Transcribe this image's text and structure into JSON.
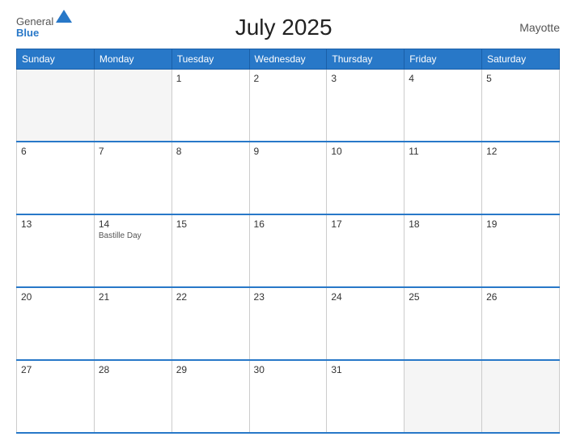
{
  "header": {
    "logo_general": "General",
    "logo_blue": "Blue",
    "title": "July 2025",
    "region": "Mayotte"
  },
  "days_of_week": [
    "Sunday",
    "Monday",
    "Tuesday",
    "Wednesday",
    "Thursday",
    "Friday",
    "Saturday"
  ],
  "weeks": [
    [
      {
        "num": "",
        "empty": true
      },
      {
        "num": "",
        "empty": true
      },
      {
        "num": "1",
        "empty": false
      },
      {
        "num": "2",
        "empty": false
      },
      {
        "num": "3",
        "empty": false
      },
      {
        "num": "4",
        "empty": false
      },
      {
        "num": "5",
        "empty": false
      }
    ],
    [
      {
        "num": "6",
        "empty": false
      },
      {
        "num": "7",
        "empty": false
      },
      {
        "num": "8",
        "empty": false
      },
      {
        "num": "9",
        "empty": false
      },
      {
        "num": "10",
        "empty": false
      },
      {
        "num": "11",
        "empty": false
      },
      {
        "num": "12",
        "empty": false
      }
    ],
    [
      {
        "num": "13",
        "empty": false
      },
      {
        "num": "14",
        "holiday": "Bastille Day",
        "empty": false
      },
      {
        "num": "15",
        "empty": false
      },
      {
        "num": "16",
        "empty": false
      },
      {
        "num": "17",
        "empty": false
      },
      {
        "num": "18",
        "empty": false
      },
      {
        "num": "19",
        "empty": false
      }
    ],
    [
      {
        "num": "20",
        "empty": false
      },
      {
        "num": "21",
        "empty": false
      },
      {
        "num": "22",
        "empty": false
      },
      {
        "num": "23",
        "empty": false
      },
      {
        "num": "24",
        "empty": false
      },
      {
        "num": "25",
        "empty": false
      },
      {
        "num": "26",
        "empty": false
      }
    ],
    [
      {
        "num": "27",
        "empty": false
      },
      {
        "num": "28",
        "empty": false
      },
      {
        "num": "29",
        "empty": false
      },
      {
        "num": "30",
        "empty": false
      },
      {
        "num": "31",
        "empty": false
      },
      {
        "num": "",
        "empty": true
      },
      {
        "num": "",
        "empty": true
      }
    ]
  ]
}
